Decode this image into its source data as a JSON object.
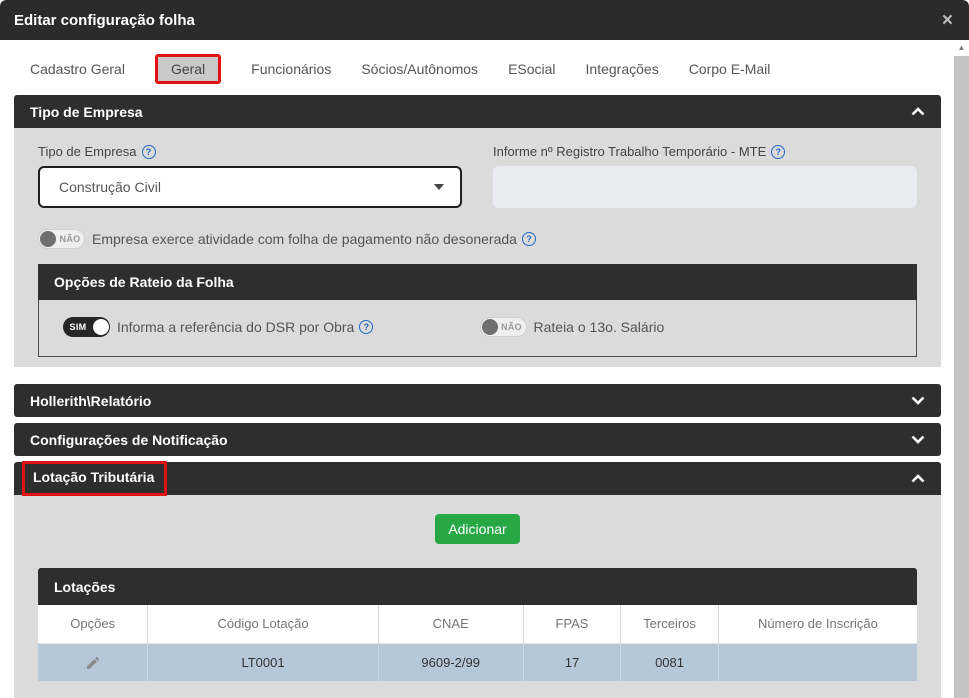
{
  "modal": {
    "title": "Editar configuração folha",
    "close_icon": "×"
  },
  "tabs": [
    {
      "label": "Cadastro Geral",
      "active": false
    },
    {
      "label": "Geral",
      "active": true
    },
    {
      "label": "Funcionários",
      "active": false
    },
    {
      "label": "Sócios/Autônomos",
      "active": false
    },
    {
      "label": "ESocial",
      "active": false
    },
    {
      "label": "Integrações",
      "active": false
    },
    {
      "label": "Corpo E-Mail",
      "active": false
    }
  ],
  "sections": {
    "tipo_empresa": {
      "title": "Tipo de Empresa",
      "tipo_field": {
        "label": "Tipo de Empresa",
        "value": "Construção Civil"
      },
      "mte_field": {
        "label": "Informe nº Registro Trabalho Temporário - MTE",
        "value": ""
      },
      "toggle_desonerada": {
        "state": "NÃO",
        "label": "Empresa exerce atividade com folha de pagamento não desonerada"
      },
      "rateio": {
        "title": "Opções de Rateio da Folha",
        "toggle_dsr": {
          "state": "SIM",
          "label": "Informa a referência do DSR por Obra"
        },
        "toggle_13": {
          "state": "NÃO",
          "label": "Rateia o 13o. Salário"
        }
      }
    },
    "hollerith": {
      "title": "Hollerith\\Relatório"
    },
    "notificacao": {
      "title": "Configurações de Notificação"
    },
    "lotacao": {
      "title": "Lotação Tributária",
      "add_button": "Adicionar",
      "table": {
        "title": "Lotações",
        "columns": [
          "Opções",
          "Código Lotação",
          "CNAE",
          "FPAS",
          "Terceiros",
          "Número de Inscrição"
        ],
        "rows": [
          {
            "codigo": "LT0001",
            "cnae": "9609-2/99",
            "fpas": "17",
            "terceiros": "0081",
            "inscricao": ""
          }
        ]
      }
    }
  },
  "icons": {
    "help": "?",
    "scroll_up_arrow": "▲"
  },
  "colors": {
    "dark_bar": "#2e2e2e",
    "annotation_red": "#e01212",
    "button_green": "#28a745",
    "row_blue": "#b6c8d7",
    "help_blue": "#2268c6",
    "section_bg": "#dbdbdb"
  }
}
